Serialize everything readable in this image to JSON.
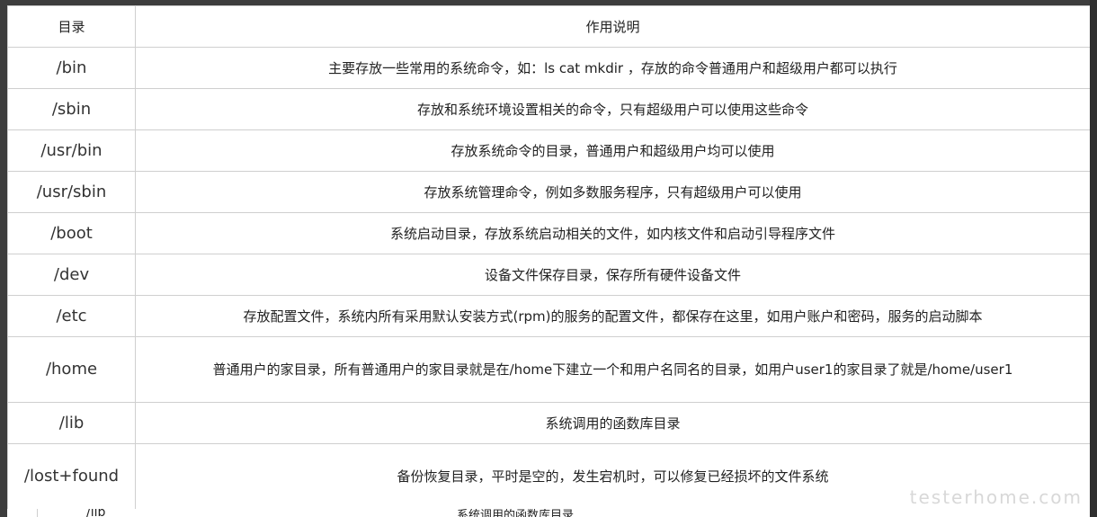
{
  "table": {
    "header": {
      "dir": "目录",
      "desc": "作用说明"
    },
    "rows": [
      {
        "dir": "/bin",
        "desc": "主要存放一些常用的系统命令，如：ls  cat  mkdir ，存放的命令普通用户和超级用户都可以执行"
      },
      {
        "dir": "/sbin",
        "desc": "存放和系统环境设置相关的命令，只有超级用户可以使用这些命令"
      },
      {
        "dir": "/usr/bin",
        "desc": "存放系统命令的目录，普通用户和超级用户均可以使用"
      },
      {
        "dir": "/usr/sbin",
        "desc": "存放系统管理命令，例如多数服务程序，只有超级用户可以使用"
      },
      {
        "dir": "/boot",
        "desc": "系统启动目录，存放系统启动相关的文件，如内核文件和启动引导程序文件"
      },
      {
        "dir": "/dev",
        "desc": "设备文件保存目录，保存所有硬件设备文件"
      },
      {
        "dir": "/etc",
        "desc": "存放配置文件，系统内所有采用默认安装方式(rpm)的服务的配置文件，都保存在这里，如用户账户和密码，服务的启动脚本"
      },
      {
        "dir": "/home",
        "desc": "普通用户的家目录，所有普通用户的家目录就是在/home下建立一个和用户名同名的目录，如用户user1的家目录了就是/home/user1"
      },
      {
        "dir": "/lib",
        "desc": "系统调用的函数库目录"
      },
      {
        "dir": "/lost+found",
        "desc": "备份恢复目录，平时是空的，发生宕机时，可以修复已经损坏的文件系统"
      }
    ],
    "cut_row": {
      "dir": "/lib",
      "desc": "系统调用的函数库目录"
    }
  },
  "watermark": "testerhome.com"
}
